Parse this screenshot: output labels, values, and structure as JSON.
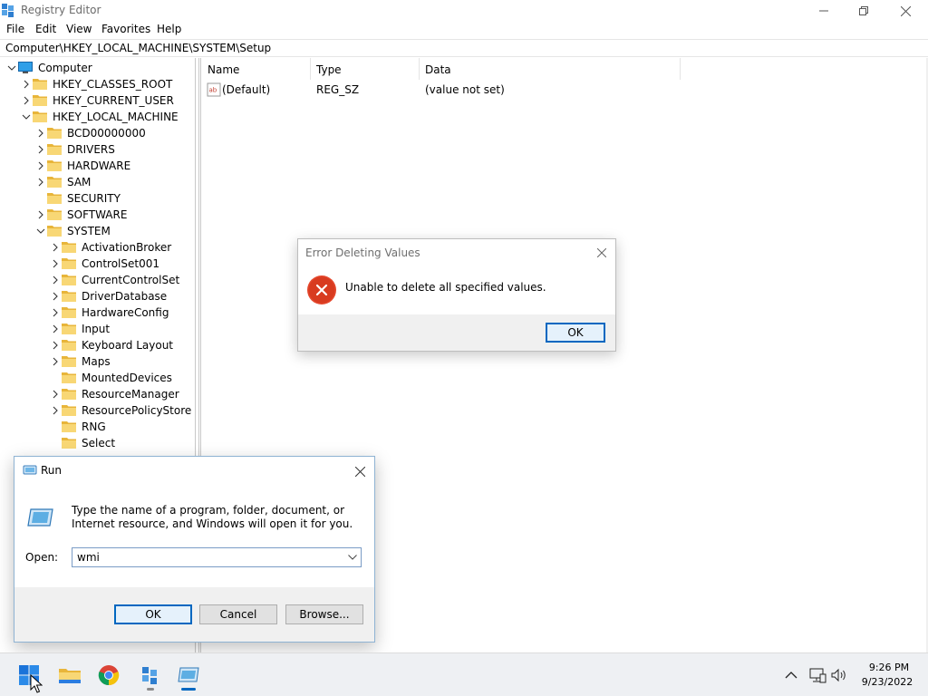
{
  "regedit": {
    "title": "Registry Editor",
    "menu": [
      "File",
      "Edit",
      "View",
      "Favorites",
      "Help"
    ],
    "address": "Computer\\HKEY_LOCAL_MACHINE\\SYSTEM\\Setup",
    "tree": [
      {
        "label": "Computer",
        "icon": "computer-icon",
        "expander": "expanded"
      },
      {
        "label": "HKEY_CLASSES_ROOT",
        "icon": "folder-icon",
        "expander": "collapsed"
      },
      {
        "label": "HKEY_CURRENT_USER",
        "icon": "folder-icon",
        "expander": "collapsed"
      },
      {
        "label": "HKEY_LOCAL_MACHINE",
        "icon": "folder-icon",
        "expander": "expanded"
      },
      {
        "label": "BCD00000000",
        "icon": "folder-icon",
        "expander": "collapsed"
      },
      {
        "label": "DRIVERS",
        "icon": "folder-icon",
        "expander": "collapsed"
      },
      {
        "label": "HARDWARE",
        "icon": "folder-icon",
        "expander": "collapsed"
      },
      {
        "label": "SAM",
        "icon": "folder-icon",
        "expander": "collapsed"
      },
      {
        "label": "SECURITY",
        "icon": "folder-icon",
        "expander": "none"
      },
      {
        "label": "SOFTWARE",
        "icon": "folder-icon",
        "expander": "collapsed"
      },
      {
        "label": "SYSTEM",
        "icon": "folder-icon",
        "expander": "expanded"
      },
      {
        "label": "ActivationBroker",
        "icon": "folder-icon",
        "expander": "collapsed"
      },
      {
        "label": "ControlSet001",
        "icon": "folder-icon",
        "expander": "collapsed"
      },
      {
        "label": "CurrentControlSet",
        "icon": "folder-icon",
        "expander": "collapsed"
      },
      {
        "label": "DriverDatabase",
        "icon": "folder-icon",
        "expander": "collapsed"
      },
      {
        "label": "HardwareConfig",
        "icon": "folder-icon",
        "expander": "collapsed"
      },
      {
        "label": "Input",
        "icon": "folder-icon",
        "expander": "collapsed"
      },
      {
        "label": "Keyboard Layout",
        "icon": "folder-icon",
        "expander": "collapsed"
      },
      {
        "label": "Maps",
        "icon": "folder-icon",
        "expander": "collapsed"
      },
      {
        "label": "MountedDevices",
        "icon": "folder-icon",
        "expander": "none"
      },
      {
        "label": "ResourceManager",
        "icon": "folder-icon",
        "expander": "collapsed"
      },
      {
        "label": "ResourcePolicyStore",
        "icon": "folder-icon",
        "expander": "collapsed"
      },
      {
        "label": "RNG",
        "icon": "folder-icon",
        "expander": "none"
      },
      {
        "label": "Select",
        "icon": "folder-icon",
        "expander": "none"
      }
    ],
    "columns": [
      "Name",
      "Type",
      "Data"
    ],
    "values": [
      {
        "name": "(Default)",
        "type": "REG_SZ",
        "data": "(value not set)",
        "icon": "string-value-icon"
      }
    ]
  },
  "error_dialog": {
    "title": "Error Deleting Values",
    "message": "Unable to delete all specified values.",
    "ok_label": "OK",
    "icon": "error-icon"
  },
  "run_dialog": {
    "title": "Run",
    "description": "Type the name of a program, folder, document, or Internet resource, and Windows will open it for you.",
    "open_label": "Open:",
    "input_value": "wmi",
    "ok_label": "OK",
    "cancel_label": "Cancel",
    "browse_label": "Browse..."
  },
  "taskbar": {
    "apps": [
      "start-icon",
      "file-explorer-icon",
      "chrome-icon",
      "registry-editor-icon",
      "run-icon"
    ],
    "time": "9:26 PM",
    "date": "9/23/2022"
  },
  "colors": {
    "accent": "#0067c0",
    "error": "#e81123",
    "folder": "#f8d775",
    "taskbar": "#eef0f3"
  }
}
